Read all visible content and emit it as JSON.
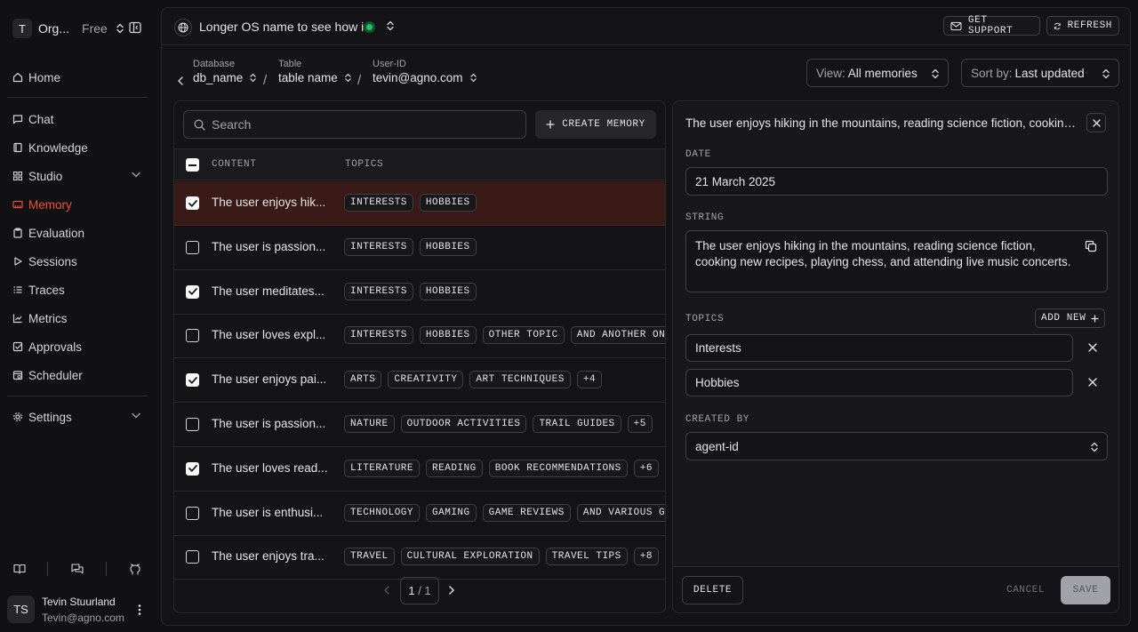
{
  "org": {
    "initial": "T",
    "name": "Org...",
    "plan": "Free"
  },
  "nav": {
    "home": "Home",
    "chat": "Chat",
    "knowledge": "Knowledge",
    "studio": "Studio",
    "memory": "Memory",
    "evaluation": "Evaluation",
    "sessions": "Sessions",
    "traces": "Traces",
    "metrics": "Metrics",
    "approvals": "Approvals",
    "scheduler": "Scheduler",
    "settings": "Settings"
  },
  "user": {
    "initials": "TS",
    "name": "Tevin Stuurland",
    "email": "Tevin@agno.com"
  },
  "topbar": {
    "os_name": "Longer OS name to see how i...",
    "support_label": "GET SUPPORT",
    "refresh_label": "REFRESH"
  },
  "breadcrumb": {
    "database_label": "Database",
    "database_value": "db_name",
    "table_label": "Table",
    "table_value": "table name",
    "userid_label": "User-ID",
    "userid_value": "tevin@agno.com",
    "separator": "/"
  },
  "filters": {
    "view_prefix": "View:",
    "view_value": "All memories",
    "sort_prefix": "Sort by:",
    "sort_value": "Last updated"
  },
  "list": {
    "search_placeholder": "Search",
    "create_label": "CREATE MEMORY",
    "col_content": "CONTENT",
    "col_topics": "TOPICS",
    "rows": [
      {
        "content": "The user enjoys hik...",
        "checked": true,
        "selected": true,
        "topics": [
          "INTERESTS",
          "HOBBIES"
        ]
      },
      {
        "content": "The user is passion...",
        "checked": false,
        "selected": false,
        "topics": [
          "INTERESTS",
          "HOBBIES"
        ]
      },
      {
        "content": "The user meditates...",
        "checked": true,
        "selected": false,
        "topics": [
          "INTERESTS",
          "HOBBIES"
        ]
      },
      {
        "content": "The user loves expl...",
        "checked": false,
        "selected": false,
        "topics": [
          "INTERESTS",
          "HOBBIES",
          "OTHER TOPIC",
          "AND ANOTHER ONE V"
        ]
      },
      {
        "content": "The user enjoys pai...",
        "checked": true,
        "selected": false,
        "topics": [
          "ARTS",
          "CREATIVITY",
          "ART TECHNIQUES",
          "+4"
        ]
      },
      {
        "content": "The user is passion...",
        "checked": false,
        "selected": false,
        "topics": [
          "NATURE",
          "OUTDOOR ACTIVITIES",
          "TRAIL GUIDES",
          "+5"
        ]
      },
      {
        "content": "The user loves read...",
        "checked": true,
        "selected": false,
        "topics": [
          "LITERATURE",
          "READING",
          "BOOK RECOMMENDATIONS",
          "+6"
        ]
      },
      {
        "content": "The user is enthusi...",
        "checked": false,
        "selected": false,
        "topics": [
          "TECHNOLOGY",
          "GAMING",
          "GAME REVIEWS",
          "AND VARIOUS GAMI"
        ]
      },
      {
        "content": "The user enjoys tra...",
        "checked": false,
        "selected": false,
        "topics": [
          "TRAVEL",
          "CULTURAL EXPLORATION",
          "TRAVEL TIPS",
          "+8"
        ]
      }
    ],
    "page_current": "1",
    "page_sep": " / ",
    "page_total": "1"
  },
  "detail": {
    "title": "The user enjoys hiking in the mountains, reading science fiction, cooking ne...",
    "date_label": "DATE",
    "date_value": "21 March 2025",
    "string_label": "STRING",
    "string_value": "The user enjoys hiking in the mountains, reading science fiction, cooking new recipes, playing chess, and attending live music concerts.",
    "topics_label": "TOPICS",
    "add_new_label": "ADD NEW",
    "topics": [
      "Interests",
      "Hobbies"
    ],
    "created_by_label": "CREATED BY",
    "created_by_value": "agent-id",
    "delete_label": "DELETE",
    "cancel_label": "CANCEL",
    "save_label": "SAVE"
  },
  "colors": {
    "accent": "#ef4f39",
    "selected_row": "#3a1a17",
    "status_online": "#22c55e",
    "background": "#111113"
  }
}
